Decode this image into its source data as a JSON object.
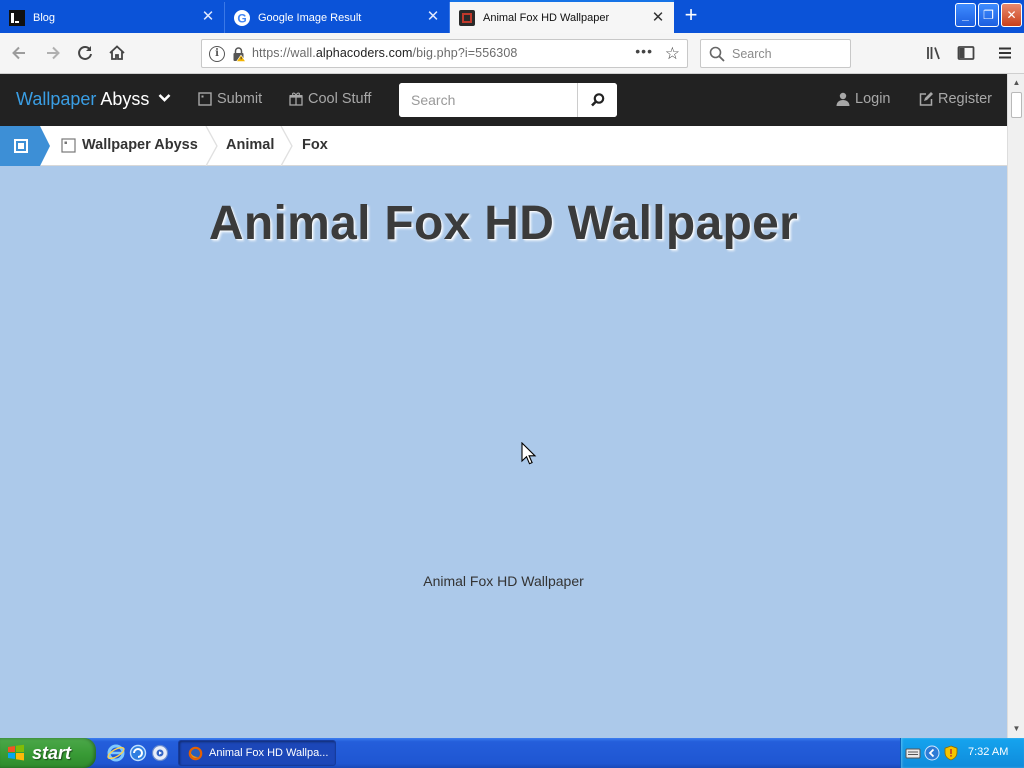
{
  "browser": {
    "tabs": [
      {
        "title": "Blog",
        "favicon": "blog-favicon",
        "active": false
      },
      {
        "title": "Google Image Result",
        "favicon": "google-g-icon",
        "active": false
      },
      {
        "title": "Animal Fox HD Wallpaper",
        "favicon": "wallpaper-abyss-favicon",
        "active": true
      }
    ],
    "url_prefix": "https://wall.",
    "url_domain": "alphacoders.com",
    "url_path": "/big.php?i=556308",
    "search_placeholder": "Search"
  },
  "site": {
    "brand_primary": "Wallpaper",
    "brand_secondary": "Abyss",
    "nav": {
      "submit": "Submit",
      "cool_stuff": "Cool Stuff",
      "login": "Login",
      "register": "Register"
    },
    "search_placeholder": "Search",
    "breadcrumb": [
      "Wallpaper Abyss",
      "Animal",
      "Fox"
    ],
    "colors": {
      "accent": "#3d8fd6",
      "header_bg": "#222222",
      "page_bg": "#acc9ea"
    }
  },
  "page": {
    "title": "Animal Fox HD Wallpaper",
    "image_alt_text": "Animal Fox HD Wallpaper"
  },
  "taskbar": {
    "start_label": "start",
    "task_button": "Animal Fox HD Wallpa...",
    "clock": "7:32 AM"
  }
}
